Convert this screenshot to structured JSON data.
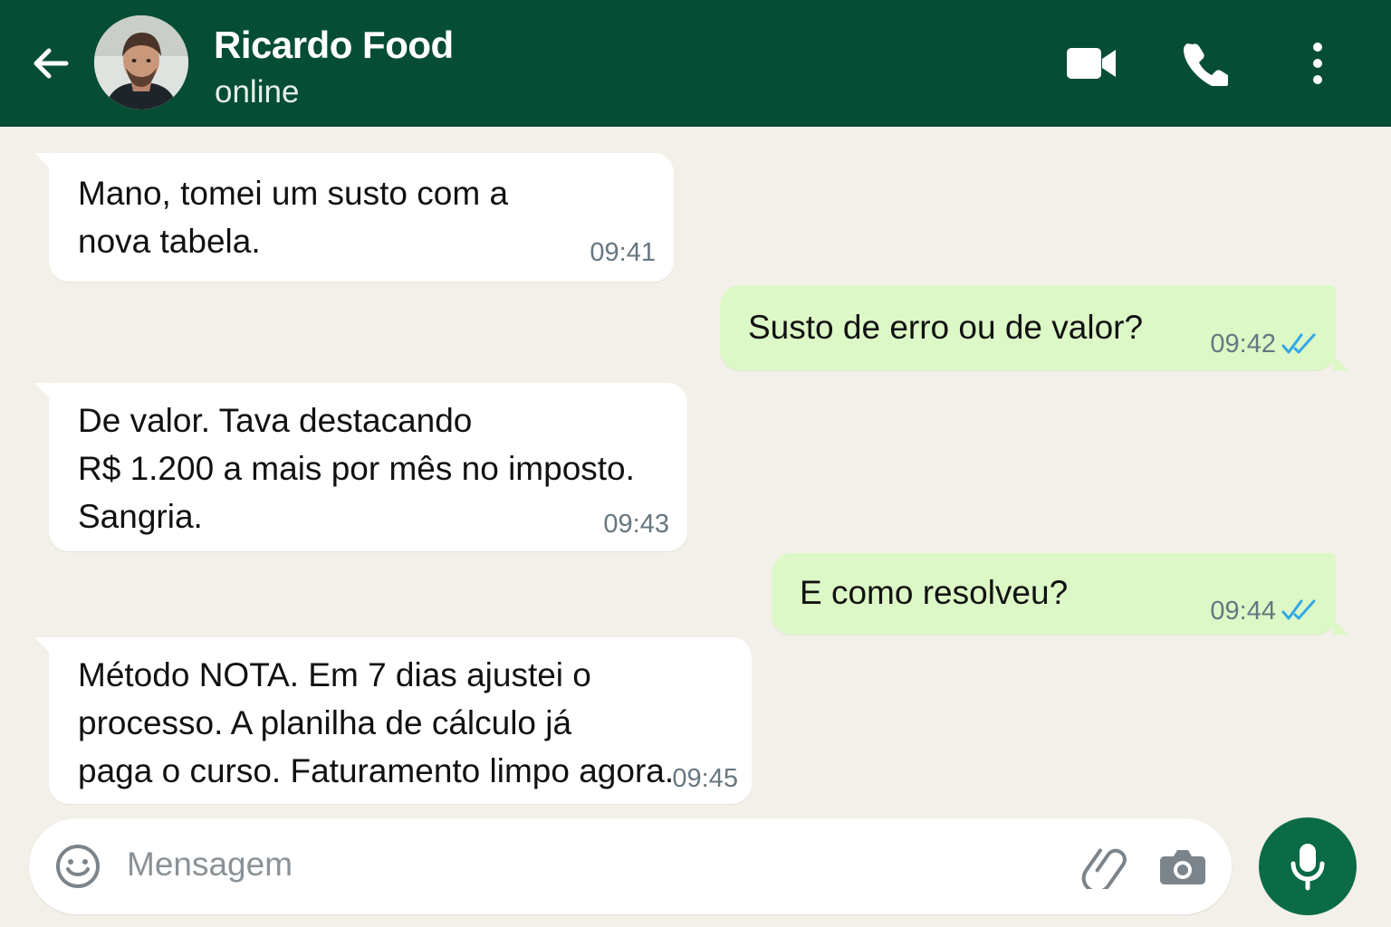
{
  "header": {
    "contact_name": "Ricardo Food",
    "status": "online",
    "back_icon": "arrow-left-icon",
    "video_icon": "video-camera-icon",
    "call_icon": "phone-icon",
    "menu_icon": "more-vertical-icon"
  },
  "messages": [
    {
      "direction": "incoming",
      "text": "Mano, tomei um susto com a\nnova tabela.",
      "time": "09:41"
    },
    {
      "direction": "outgoing",
      "text": "Susto de erro ou de valor?",
      "time": "09:42",
      "status": "read"
    },
    {
      "direction": "incoming",
      "text": "De valor. Tava destacando\nR$ 1.200 a mais por mês no imposto.\nSangria.",
      "time": "09:43"
    },
    {
      "direction": "outgoing",
      "text": "E como resolveu?",
      "time": "09:44",
      "status": "read"
    },
    {
      "direction": "incoming",
      "text": "Método NOTA. Em 7 dias ajustei o\nprocesso. A planilha de cálculo já\npaga o curso. Faturamento limpo agora.",
      "time": "09:45"
    }
  ],
  "composer": {
    "placeholder": "Mensagem",
    "emoji_icon": "emoji-icon",
    "attach_icon": "paperclip-icon",
    "camera_icon": "camera-icon",
    "mic_icon": "microphone-icon"
  },
  "colors": {
    "header": "#054d34",
    "chat_background": "#f3f0e9",
    "incoming_bubble": "#ffffff",
    "outgoing_bubble": "#dcf8c6",
    "read_ticks": "#34a8e8",
    "mic_button": "#0a6b46"
  }
}
